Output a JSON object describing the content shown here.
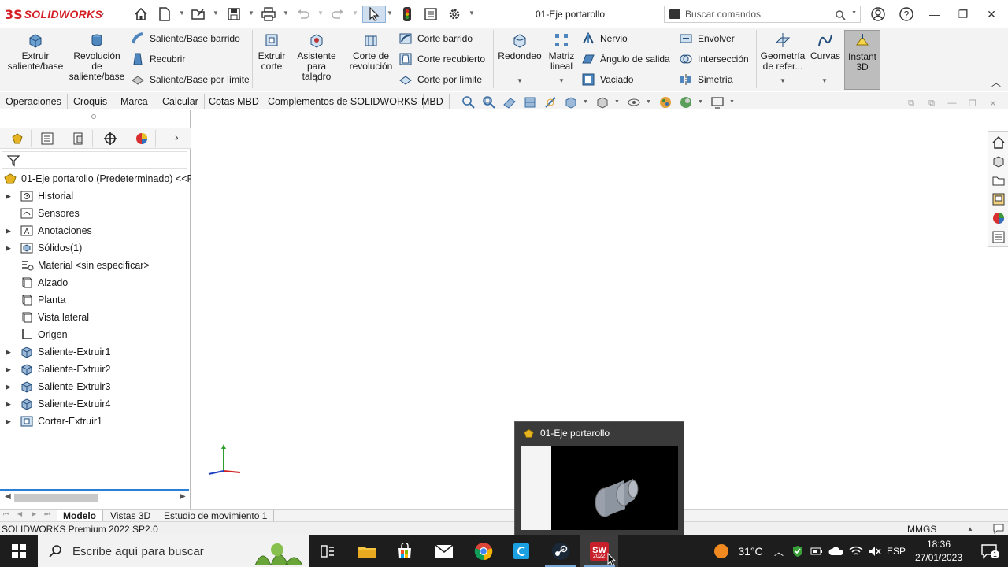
{
  "app": {
    "logo_ds": "3S",
    "logo_name": "SOLIDWORKS",
    "document_title": "01-Eje portarollo"
  },
  "search": {
    "placeholder": "Buscar comandos"
  },
  "ribbon": {
    "extruir_saliente": "Extruir saliente/base",
    "revolucion_saliente": "Revolución de saliente/base",
    "saliente_barrido": "Saliente/Base barrido",
    "recubrir": "Recubrir",
    "saliente_limite": "Saliente/Base por límite",
    "extruir_corte": "Extruir corte",
    "asistente_taladro": "Asistente para taladro",
    "corte_revolucion": "Corte de revolución",
    "corte_barrido": "Corte barrido",
    "corte_recubierto": "Corte recubierto",
    "corte_limite": "Corte por límite",
    "redondeo": "Redondeo",
    "matriz_lineal": "Matriz lineal",
    "nervio": "Nervio",
    "angulo_salida": "Ángulo de salida",
    "vaciado": "Vaciado",
    "envolver": "Envolver",
    "interseccion": "Intersección",
    "simetria": "Simetría",
    "geometria_ref": "Geometría de refer...",
    "curvas": "Curvas",
    "instant3d": "Instant 3D"
  },
  "command_tabs": [
    "Operaciones",
    "Croquis",
    "Marca",
    "Calcular",
    "Cotas MBD",
    "Complementos de SOLIDWORKS",
    "MBD"
  ],
  "feature_tree": {
    "root": "01-Eje portarollo (Predeterminado) <<Pr",
    "items": [
      {
        "label": "Historial",
        "icon": "history-folder-icon",
        "expandable": true
      },
      {
        "label": "Sensores",
        "icon": "sensors-folder-icon",
        "expandable": false
      },
      {
        "label": "Anotaciones",
        "icon": "annotations-icon",
        "expandable": true
      },
      {
        "label": "Sólidos(1)",
        "icon": "solid-bodies-icon",
        "expandable": true
      },
      {
        "label": "Material <sin especificar>",
        "icon": "material-icon",
        "expandable": false
      },
      {
        "label": "Alzado",
        "icon": "plane-icon",
        "expandable": false
      },
      {
        "label": "Planta",
        "icon": "plane-icon",
        "expandable": false
      },
      {
        "label": "Vista lateral",
        "icon": "plane-icon",
        "expandable": false
      },
      {
        "label": "Origen",
        "icon": "origin-icon",
        "expandable": false
      },
      {
        "label": "Saliente-Extruir1",
        "icon": "extrude-boss-icon",
        "expandable": true
      },
      {
        "label": "Saliente-Extruir2",
        "icon": "extrude-boss-icon",
        "expandable": true
      },
      {
        "label": "Saliente-Extruir3",
        "icon": "extrude-boss-icon",
        "expandable": true
      },
      {
        "label": "Saliente-Extruir4",
        "icon": "extrude-boss-icon",
        "expandable": true
      },
      {
        "label": "Cortar-Extruir1",
        "icon": "extrude-cut-icon",
        "expandable": true
      }
    ]
  },
  "model_tabs": [
    "Modelo",
    "Vistas 3D",
    "Estudio de movimiento 1"
  ],
  "status": {
    "text": "SOLIDWORKS Premium 2022 SP2.0",
    "units": "MMGS"
  },
  "preview": {
    "title": "01-Eje portarollo"
  },
  "taskbar": {
    "search_placeholder": "Escribe aquí para buscar",
    "temperature": "31°C",
    "language": "ESP",
    "time": "18:36",
    "date": "27/01/2023",
    "notification_count": "1",
    "sw_badge": "2022"
  },
  "colors": {
    "brand_red": "#d41f26",
    "selection_blue": "#2b7fd4",
    "taskbar_bg": "#1d1d1d"
  }
}
